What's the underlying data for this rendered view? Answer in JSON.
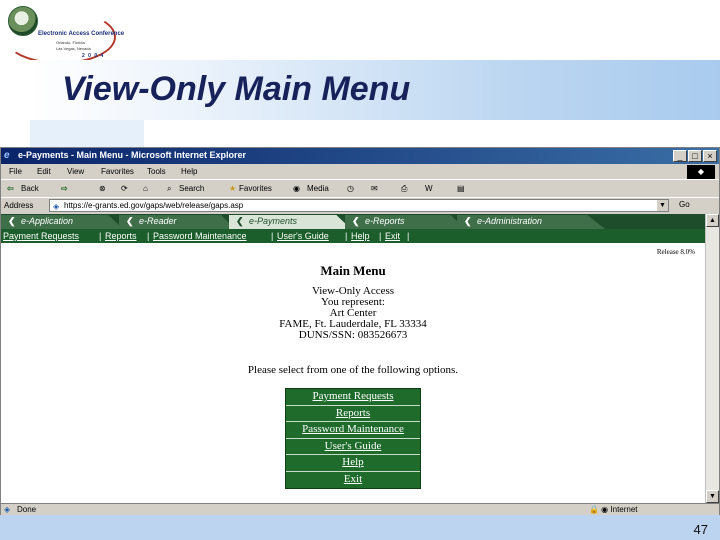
{
  "logo": {
    "title": "Electronic Access Conference",
    "location_line1": "Orlando, Florida",
    "location_line2": "Las Vegas, Nevada",
    "year": "2 0 0 4"
  },
  "slide": {
    "title": "View-Only Main Menu",
    "page_number": "47",
    "colors": {
      "title": "#17215a",
      "band": "#a9cbee"
    }
  },
  "browser": {
    "window_title": "e-Payments - Main Menu - Microsoft Internet Explorer",
    "menu": [
      "File",
      "Edit",
      "View",
      "Favorites",
      "Tools",
      "Help"
    ],
    "toolbar": {
      "back": "Back",
      "search": "Search",
      "favorites": "Favorites",
      "media": "Media"
    },
    "address": {
      "label": "Address",
      "url": "https://e-grants.ed.gov/gaps/web/release/gaps.asp",
      "go": "Go"
    },
    "status": {
      "text": "Done",
      "zone": "Internet"
    },
    "window_buttons": {
      "minimize": "_",
      "maximize": "□",
      "close": "×"
    }
  },
  "app": {
    "tabs": [
      "e-Application",
      "e-Reader",
      "e-Payments",
      "e-Reports",
      "e-Administration"
    ],
    "active_tab": "e-Payments",
    "nav": [
      "Payment Requests",
      "Reports",
      "Password Maintenance",
      "User's Guide",
      "Help",
      "Exit"
    ],
    "colors": {
      "tab_bar": "#1e4d2b",
      "nav_bar": "#1b5e2b",
      "options": "#1e6b2c"
    }
  },
  "page": {
    "release": "Release 8.0%",
    "heading": "Main Menu",
    "access": "View-Only Access",
    "represent": "You represent:",
    "contact": "Art Center",
    "institution": "FAME, Ft. Lauderdale, FL 33334",
    "duns": "DUNS/SSN: 083526673",
    "prompt": "Please select from one of the following options.",
    "options": [
      "Payment Requests",
      "Reports",
      "Password Maintenance",
      "User's Guide",
      "Help",
      "Exit"
    ]
  }
}
